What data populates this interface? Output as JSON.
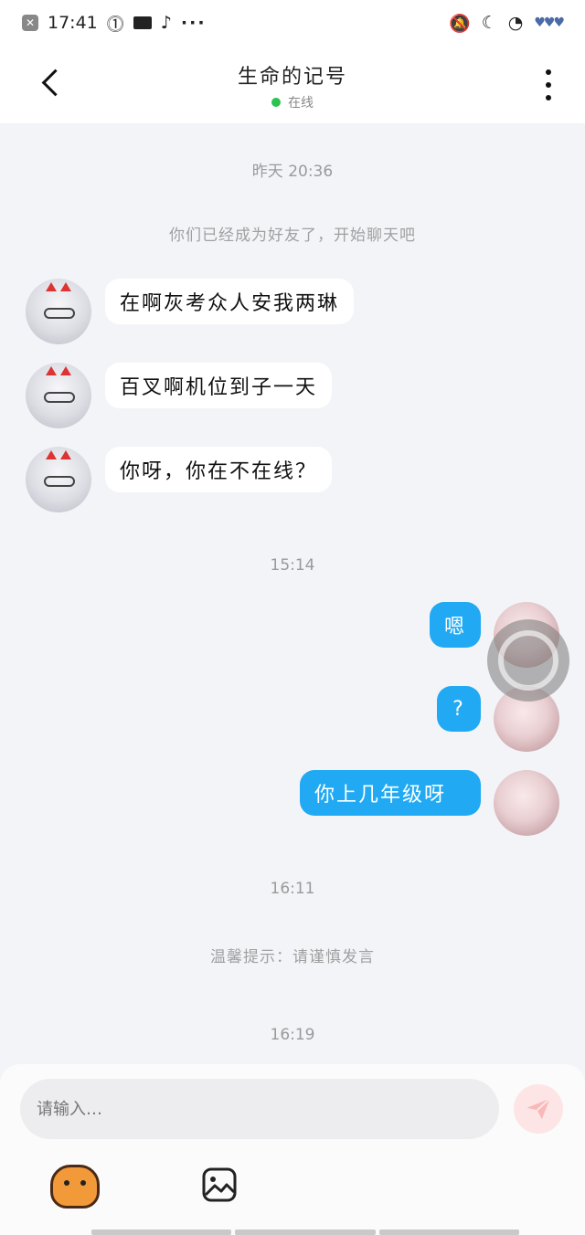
{
  "status_bar": {
    "time": "17:41",
    "more_dots": "···"
  },
  "header": {
    "title": "生命的记号",
    "status": "在线"
  },
  "messages": {
    "ts1": "昨天 20:36",
    "system1": "你们已经成为好友了，开始聊天吧",
    "in1": "在啊灰考众人安我两琳",
    "in2": "百叉啊机位到子一天",
    "in3": "你呀，你在不在线？",
    "ts2": "15:14",
    "out1": "嗯",
    "out2": "?",
    "out3": "你上几年级呀",
    "ts3": "16:11",
    "system2": "温馨提示：请谨慎发言",
    "ts4": "16:19"
  },
  "composer": {
    "placeholder": "请输入…"
  },
  "colors": {
    "accent": "#21aaf3",
    "online": "#2bc250",
    "background": "#f3f4f8"
  }
}
